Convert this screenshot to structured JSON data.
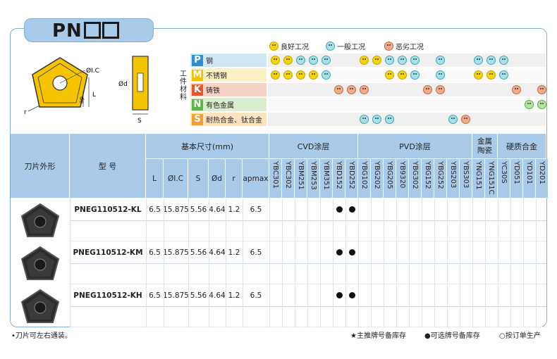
{
  "title": {
    "main": "PN",
    "boxes": "□□"
  },
  "legend": [
    {
      "label": "良好工况",
      "type": "good"
    },
    {
      "label": "一般工况",
      "type": "ok"
    },
    {
      "label": "恶劣工况",
      "type": "bad"
    }
  ],
  "conditions_label": "工件材料",
  "diagram_labels": {
    "ic": "ØI.C",
    "l": "L",
    "ap": "ap",
    "r": "r",
    "d": "Ød",
    "s": "S"
  },
  "materials": [
    {
      "letter": "P",
      "name": "钢",
      "color": "#2e8fd4",
      "bg": "#cfe6f5"
    },
    {
      "letter": "M",
      "name": "不锈钢",
      "color": "#f2c200",
      "bg": "#fbf1c4"
    },
    {
      "letter": "K",
      "name": "铸铁",
      "color": "#e05a2b",
      "bg": "#f7d3c5"
    },
    {
      "letter": "N",
      "name": "有色金属",
      "color": "#5ab54a",
      "bg": "#d8eecd"
    },
    {
      "letter": "S",
      "name": "耐热合金、钛合金",
      "color": "#f0a032",
      "bg": "#fbe3c0"
    }
  ],
  "header": {
    "shape": "刀片外形",
    "model": "型 号",
    "dims": "基本尺寸(mm)",
    "cvd": "CVD涂层",
    "pvd": "PVD涂层",
    "cermet": "金属陶瓷",
    "carbide": "硬质合金",
    "dim_cols": [
      "L",
      "ØI.C",
      "S",
      "Ød",
      "r",
      "apmax"
    ],
    "grades": [
      "YBC301",
      "YBC302",
      "YBM251",
      "YBM253",
      "YBM351",
      "YBD152",
      "YBD252",
      "YBG102",
      "YBG202",
      "YBG205",
      "YB9320",
      "YBG302",
      "YBG152",
      "YBG252",
      "YBS203",
      "YBS303",
      "YNG151",
      "YNG151C",
      "YC30S",
      "YD051",
      "YD101",
      "YD201"
    ]
  },
  "rows": [
    {
      "model": "PNEG110512-KL",
      "L": "6.5",
      "IC": "15.875",
      "S": "5.56",
      "d": "4.64",
      "r": "1.2",
      "ap": "6.5"
    },
    {
      "model": "PNEG110512-KM",
      "L": "6.5",
      "IC": "15.875",
      "S": "5.56",
      "d": "4.64",
      "r": "1.2",
      "ap": "6.5"
    },
    {
      "model": "PNEG110512-KH",
      "L": "6.5",
      "IC": "15.875",
      "S": "5.56",
      "d": "4.64",
      "r": "1.2",
      "ap": "6.5"
    }
  ],
  "footer": {
    "note": "•刀片可左右通装。",
    "star": "★主推牌号备库存",
    "dot": "●可选牌号备库存",
    "circle": "○按订单生产"
  }
}
